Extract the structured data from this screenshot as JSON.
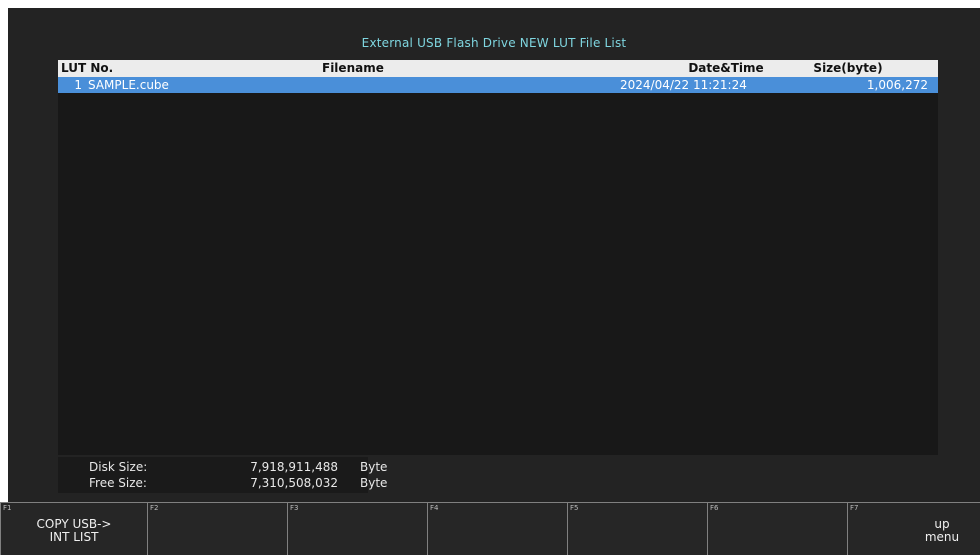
{
  "title": "External USB Flash Drive NEW LUT File List",
  "table": {
    "columns": [
      "LUT No.",
      "Filename",
      "Date&Time",
      "Size(byte)"
    ],
    "rows": [
      {
        "no": "1",
        "filename": "SAMPLE.cube",
        "datetime": "2024/04/22 11:21:24",
        "size": "1,006,272"
      }
    ]
  },
  "disk": {
    "disk_size_label": "Disk Size:",
    "disk_size_value": "7,918,911,488",
    "free_size_label": "Free Size:",
    "free_size_value": "7,310,508,032",
    "unit": "Byte"
  },
  "fkeys": [
    {
      "num": "F1",
      "label": "COPY USB->\nINT LIST"
    },
    {
      "num": "F2",
      "label": ""
    },
    {
      "num": "F3",
      "label": ""
    },
    {
      "num": "F4",
      "label": ""
    },
    {
      "num": "F5",
      "label": ""
    },
    {
      "num": "F6",
      "label": ""
    },
    {
      "num": "F7",
      "label": "up\nmenu"
    }
  ],
  "colors": {
    "title": "#7fd6e0",
    "selected_row": "#4a8fd9",
    "header_bg": "#ececec"
  }
}
